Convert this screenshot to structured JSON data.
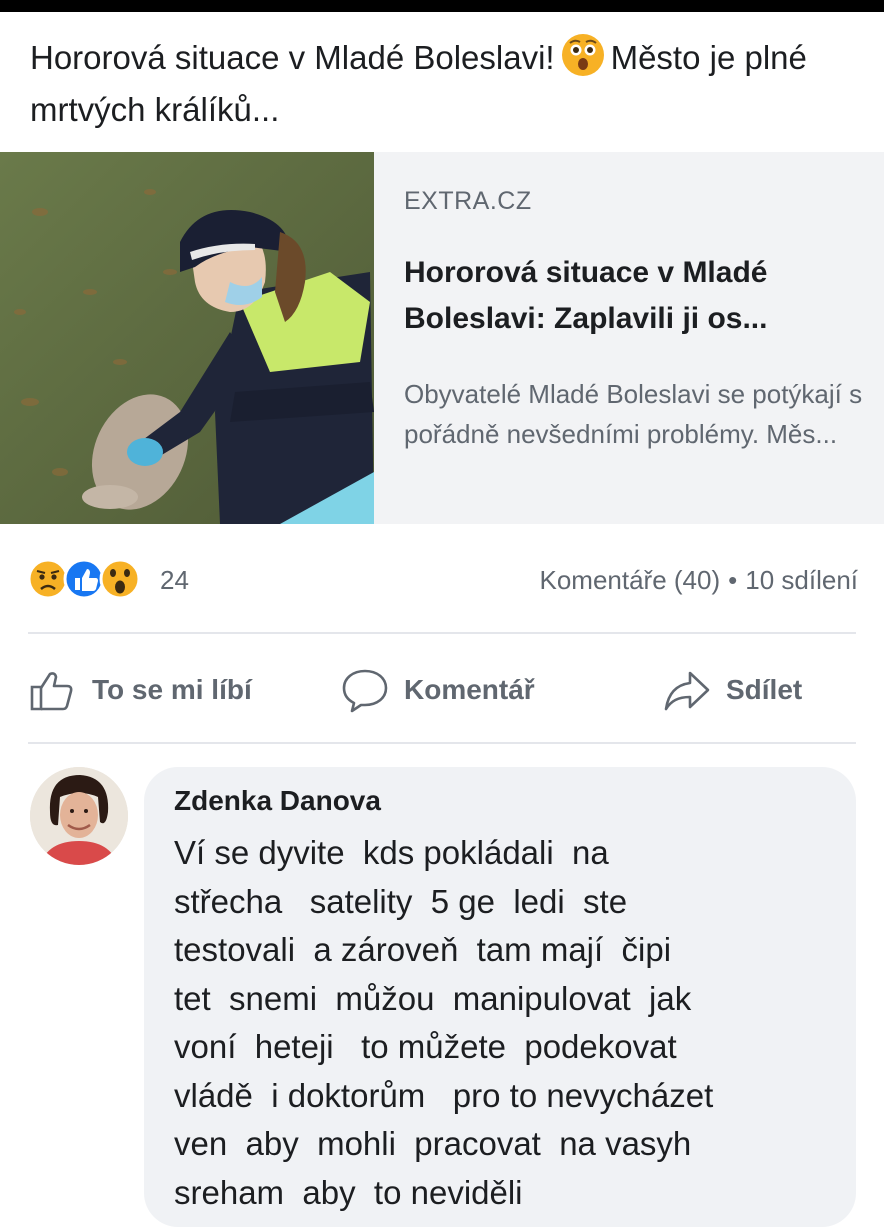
{
  "post": {
    "text_part1": "Hororová situace v Mladé Boleslavi!",
    "emoji_name": "astonished-face-icon",
    "text_part2": "Město je plné mrtvých králíků..."
  },
  "link_preview": {
    "image_description_icon": "police-officer-with-rabbit-photo",
    "domain": "EXTRA.CZ",
    "title": "Hororová situace v Mladé Boleslavi: Zaplavili ji os...",
    "description": "Obyvatelé Mladé Boleslavi se potýkají s pořádně nevšedními problémy. Měs..."
  },
  "reactions": {
    "icons": [
      "sad-reaction-icon",
      "like-reaction-icon",
      "wow-reaction-icon"
    ],
    "count": "24",
    "comments": "Komentáře (40)",
    "separator": "•",
    "shares": "10 sdílení"
  },
  "actions": {
    "like_label": "To se mi líbí",
    "comment_label": "Komentář",
    "share_label": "Sdílet"
  },
  "comment": {
    "author": "Zdenka Danova",
    "lines": [
      "Ví se dyvite  kds pokládali  na",
      "střecha   satelity  5 ge  ledi  ste",
      "testovali  a zároveň  tam mají  čipi",
      "tet  snemi  můžou  manipulovat  jak",
      "voní  heteji   to můžete  podekovat",
      "vládě  i doktorům   pro to nevycházet",
      "ven  aby  mohli  pracovat  na vasyh",
      "sreham  aby  to neviděli"
    ]
  },
  "colors": {
    "text": "#1c1e21",
    "secondary": "#606770",
    "card_bg": "#f2f3f5",
    "like_blue": "#1877f2",
    "reaction_yellow": "#f7b125"
  }
}
